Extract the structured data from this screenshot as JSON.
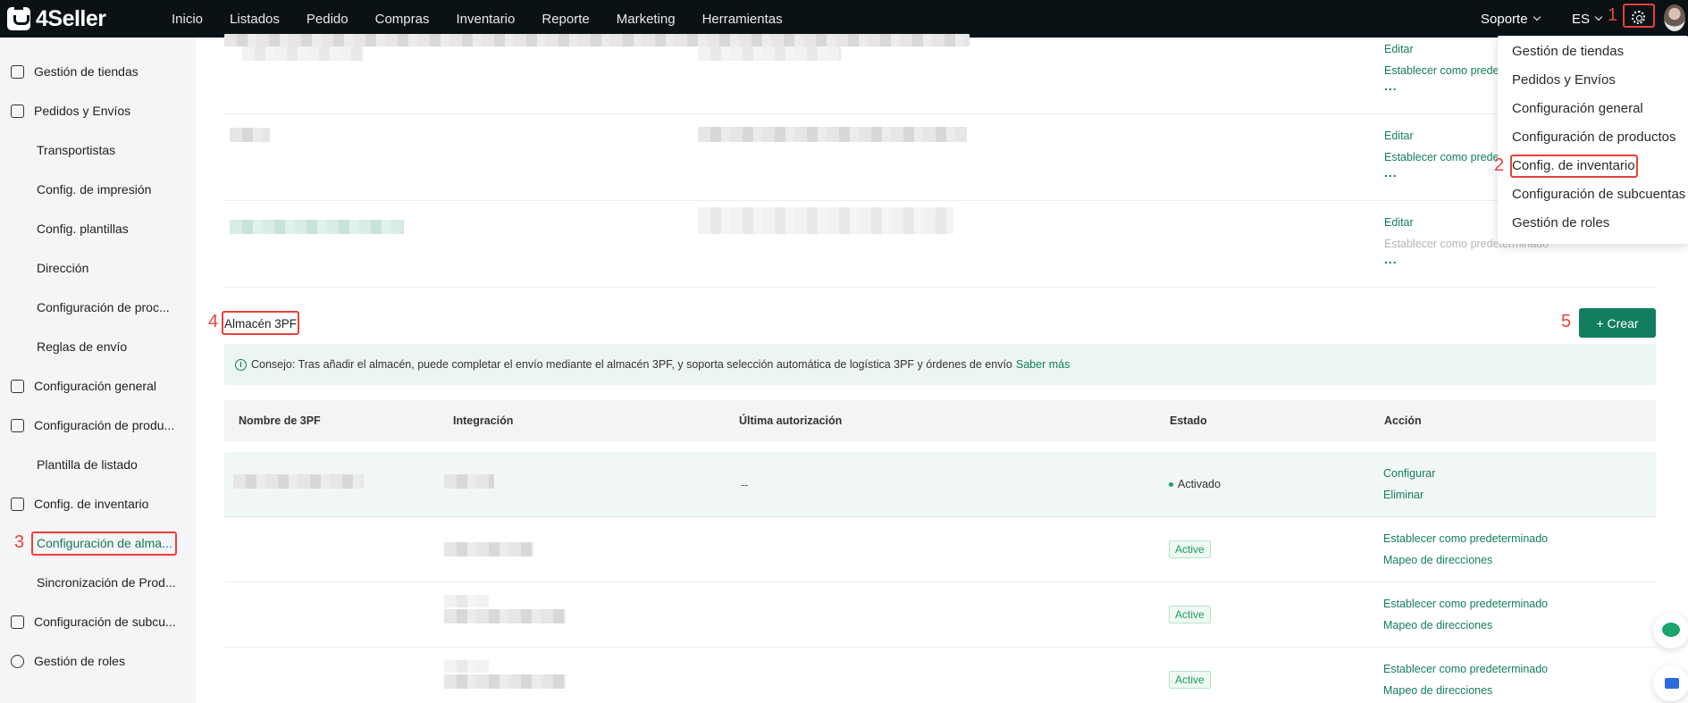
{
  "brand": {
    "name": "4Seller"
  },
  "nav": [
    "Inicio",
    "Listados",
    "Pedido",
    "Compras",
    "Inventario",
    "Reporte",
    "Marketing",
    "Herramientas"
  ],
  "topbar": {
    "support": "Soporte",
    "language": "ES",
    "gear_icon": "gear-icon"
  },
  "annotations": {
    "n1": "1",
    "n2": "2",
    "n3": "3",
    "n4": "4",
    "n5": "5"
  },
  "dropdown": {
    "items": [
      "Gestión de tiendas",
      "Pedidos y Envíos",
      "Configuración general",
      "Configuración de productos",
      "Config. de inventario",
      "Configuración de subcuentas",
      "Gestión de roles"
    ],
    "highlighted": "Config. de inventario"
  },
  "sidebar": {
    "items": [
      {
        "label": "Gestión de tiendas",
        "icon": "store-icon",
        "level": "top"
      },
      {
        "label": "Pedidos y Envíos",
        "icon": "orders-icon",
        "level": "top"
      },
      {
        "label": "Transportistas",
        "level": "sub"
      },
      {
        "label": "Config. de impresión",
        "level": "sub"
      },
      {
        "label": "Config. plantillas",
        "level": "sub"
      },
      {
        "label": "Dirección",
        "level": "sub"
      },
      {
        "label": "Configuración de proc...",
        "level": "sub"
      },
      {
        "label": "Reglas de envío",
        "level": "sub"
      },
      {
        "label": "Configuración general",
        "icon": "general-settings-icon",
        "level": "top"
      },
      {
        "label": "Configuración de produ...",
        "icon": "product-settings-icon",
        "level": "top"
      },
      {
        "label": "Plantilla de listado",
        "level": "sub"
      },
      {
        "label": "Config. de inventario",
        "icon": "inventory-icon",
        "level": "top"
      },
      {
        "label": "Configuración de alma...",
        "level": "sub",
        "active": true
      },
      {
        "label": "Sincronización de Prod...",
        "level": "sub"
      },
      {
        "label": "Configuración de subcu...",
        "icon": "subaccount-icon",
        "level": "top"
      },
      {
        "label": "Gestión de roles",
        "icon": "roles-icon",
        "level": "top"
      }
    ]
  },
  "warehouse_rows": [
    {
      "edit": "Editar",
      "set_default": "Establecer como predeterminado",
      "more": "...",
      "set_default_disabled": false
    },
    {
      "edit": "Editar",
      "set_default": "Establecer como predeterminado",
      "more": "...",
      "set_default_disabled": false
    },
    {
      "edit": "Editar",
      "set_default": "Establecer como predeterminado",
      "more": "...",
      "set_default_disabled": true
    }
  ],
  "section_3pf": {
    "title": "Almacén 3PF",
    "create_label": "+ Crear",
    "tip": "Consejo: Tras añadir el almacén, puede completar el envío mediante el almacén 3PF, y soporta selección automática de logística 3PF y órdenes de envío",
    "tip_link": "Saber más",
    "columns": [
      "Nombre de 3PF",
      "Integración",
      "Última autorización",
      "Estado",
      "Acción"
    ],
    "rows": [
      {
        "last_auth": "--",
        "status": "Activado",
        "actions": [
          "Configurar",
          "Eliminar"
        ]
      },
      {
        "status": "Active",
        "actions": [
          "Establecer como predeterminado",
          "Mapeo de direcciones"
        ]
      },
      {
        "status": "Active",
        "actions": [
          "Establecer como predeterminado",
          "Mapeo de direcciones"
        ]
      },
      {
        "status": "Active",
        "actions": [
          "Establecer como predeterminado",
          "Mapeo de direcciones"
        ]
      }
    ]
  },
  "colors": {
    "topbar": "#0b1215",
    "accent": "#137d5f",
    "annotation": "#e8413a",
    "sidebar": "#f5f5f7"
  }
}
